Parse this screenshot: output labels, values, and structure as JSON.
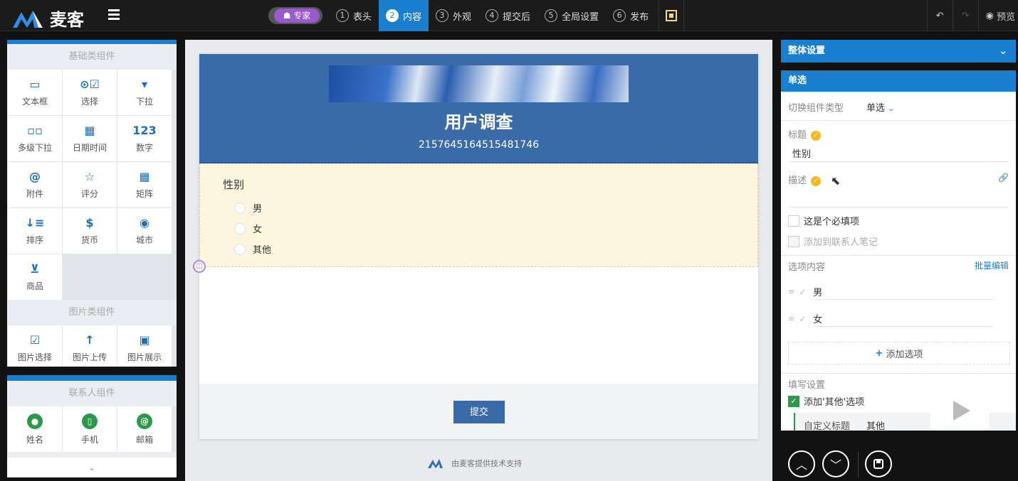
{
  "app": {
    "brand": "麦客"
  },
  "topbar": {
    "expert_label": "专家",
    "steps": [
      {
        "num": "1",
        "label": "表头"
      },
      {
        "num": "2",
        "label": "内容"
      },
      {
        "num": "3",
        "label": "外观"
      },
      {
        "num": "4",
        "label": "提交后"
      },
      {
        "num": "5",
        "label": "全局设置"
      },
      {
        "num": "6",
        "label": "发布"
      }
    ],
    "active_step": "内容",
    "preview_label": "预览"
  },
  "left": {
    "basic_title": "基础类组件",
    "basic": [
      {
        "icon": "▭",
        "label": "文本框"
      },
      {
        "icon": "⊙☑",
        "label": "选择"
      },
      {
        "icon": "▾",
        "label": "下拉"
      },
      {
        "icon": "▫▫",
        "label": "多级下拉"
      },
      {
        "icon": "▦",
        "label": "日期时间"
      },
      {
        "icon": "123",
        "label": "数字"
      },
      {
        "icon": "@",
        "label": "附件"
      },
      {
        "icon": "☆",
        "label": "评分"
      },
      {
        "icon": "▦",
        "label": "矩阵"
      },
      {
        "icon": "↓≡",
        "label": "排序"
      },
      {
        "icon": "$",
        "label": "货币"
      },
      {
        "icon": "◉",
        "label": "城市"
      },
      {
        "icon": "⊻",
        "label": "商品"
      }
    ],
    "image_title": "图片类组件",
    "image": [
      {
        "icon": "☑",
        "label": "图片选择"
      },
      {
        "icon": "↑",
        "label": "图片上传"
      },
      {
        "icon": "▣",
        "label": "图片展示"
      }
    ],
    "contact_title": "联系人组件",
    "contact": [
      {
        "icon": "●",
        "label": "姓名"
      },
      {
        "icon": "▯",
        "label": "手机"
      },
      {
        "icon": "@",
        "label": "邮箱"
      }
    ]
  },
  "form": {
    "title": "用户调查",
    "subtitle": "2157645164515481746",
    "question": {
      "title": "性别",
      "options": [
        "男",
        "女",
        "其他"
      ]
    },
    "submit_label": "提交",
    "powered_by": "由麦客提供技术支持"
  },
  "right": {
    "overall_label": "整体设置",
    "section_label": "单选",
    "switch_type_label": "切换组件类型",
    "switch_type_value": "单选",
    "title_label": "标题",
    "title_value": "性别",
    "desc_label": "描述",
    "required_label": "这是个必填项",
    "add_note_label": "添加到联系人笔记",
    "options_label": "选项内容",
    "bulk_edit_label": "批量编辑",
    "options": [
      "男",
      "女"
    ],
    "add_option_label": "添加选项",
    "fill_settings_label": "填写设置",
    "add_other_label": "添加'其他'选项",
    "custom_title_label": "自定义标题",
    "custom_title_value": "其他"
  }
}
